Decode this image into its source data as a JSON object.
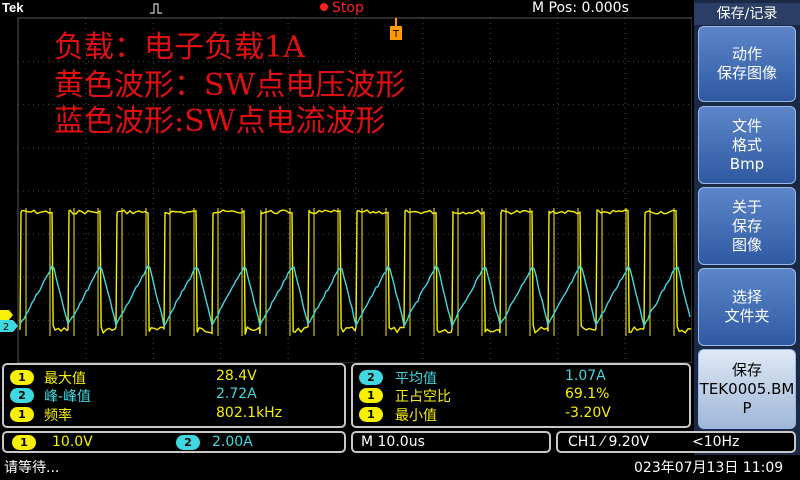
{
  "top_bar": {
    "brand": "Tek",
    "run_state": "Stop",
    "m_pos": "M Pos: 0.000s"
  },
  "overlay_notes": [
    "负载：电子负载1A",
    "黄色波形：SW点电压波形",
    "蓝色波形:SW点电流波形"
  ],
  "markers": {
    "trigger_position": "T",
    "ch2_ground": "2",
    "ch1_ground": "1"
  },
  "colors": {
    "ch1": "#f7f000",
    "ch2": "#40d8e0",
    "annotation": "#e01010",
    "stop": "#ff2020",
    "menu_button": "#3f6bb5"
  },
  "menu": {
    "title": "保存/记录",
    "buttons": [
      {
        "label": "动作\n保存图像"
      },
      {
        "label": "文件\n格式\nBmp"
      },
      {
        "label": "关于\n保存\n图像"
      },
      {
        "label": "选择\n文件夹"
      },
      {
        "label": "保存\nTEK0005.BM\nP"
      }
    ]
  },
  "measurements": {
    "left": [
      {
        "ch": "1",
        "name": "最大值",
        "value": "28.4V"
      },
      {
        "ch": "2",
        "name": "峰-峰值",
        "value": "2.72A"
      },
      {
        "ch": "1",
        "name": "频率",
        "value": "802.1kHz"
      }
    ],
    "right": [
      {
        "ch": "2",
        "name": "平均值",
        "value": "1.07A"
      },
      {
        "ch": "1",
        "name": "正占空比",
        "value": "69.1%"
      },
      {
        "ch": "1",
        "name": "最小值",
        "value": "-3.20V"
      }
    ]
  },
  "status": {
    "ch1_scale_badge": "1",
    "ch1_scale": "10.0V",
    "ch2_scale_badge": "2",
    "ch2_scale": "2.00A",
    "timebase": "M 10.0us",
    "trigger": "CH1 ⁄ 9.20V",
    "freq": "<10Hz"
  },
  "bottom": {
    "message": "请等待...",
    "datetime": "023年07月13日 11:09"
  },
  "waveforms": {
    "ch1_shape": "square-pulse",
    "ch1_high_level_v": 28.4,
    "ch1_low_level_v": -3.2,
    "ch1_duty_percent": 69.1,
    "ch2_shape": "triangle-ripple",
    "ch2_peak_to_peak_a": 2.72,
    "ch2_mean_a": 1.07
  }
}
